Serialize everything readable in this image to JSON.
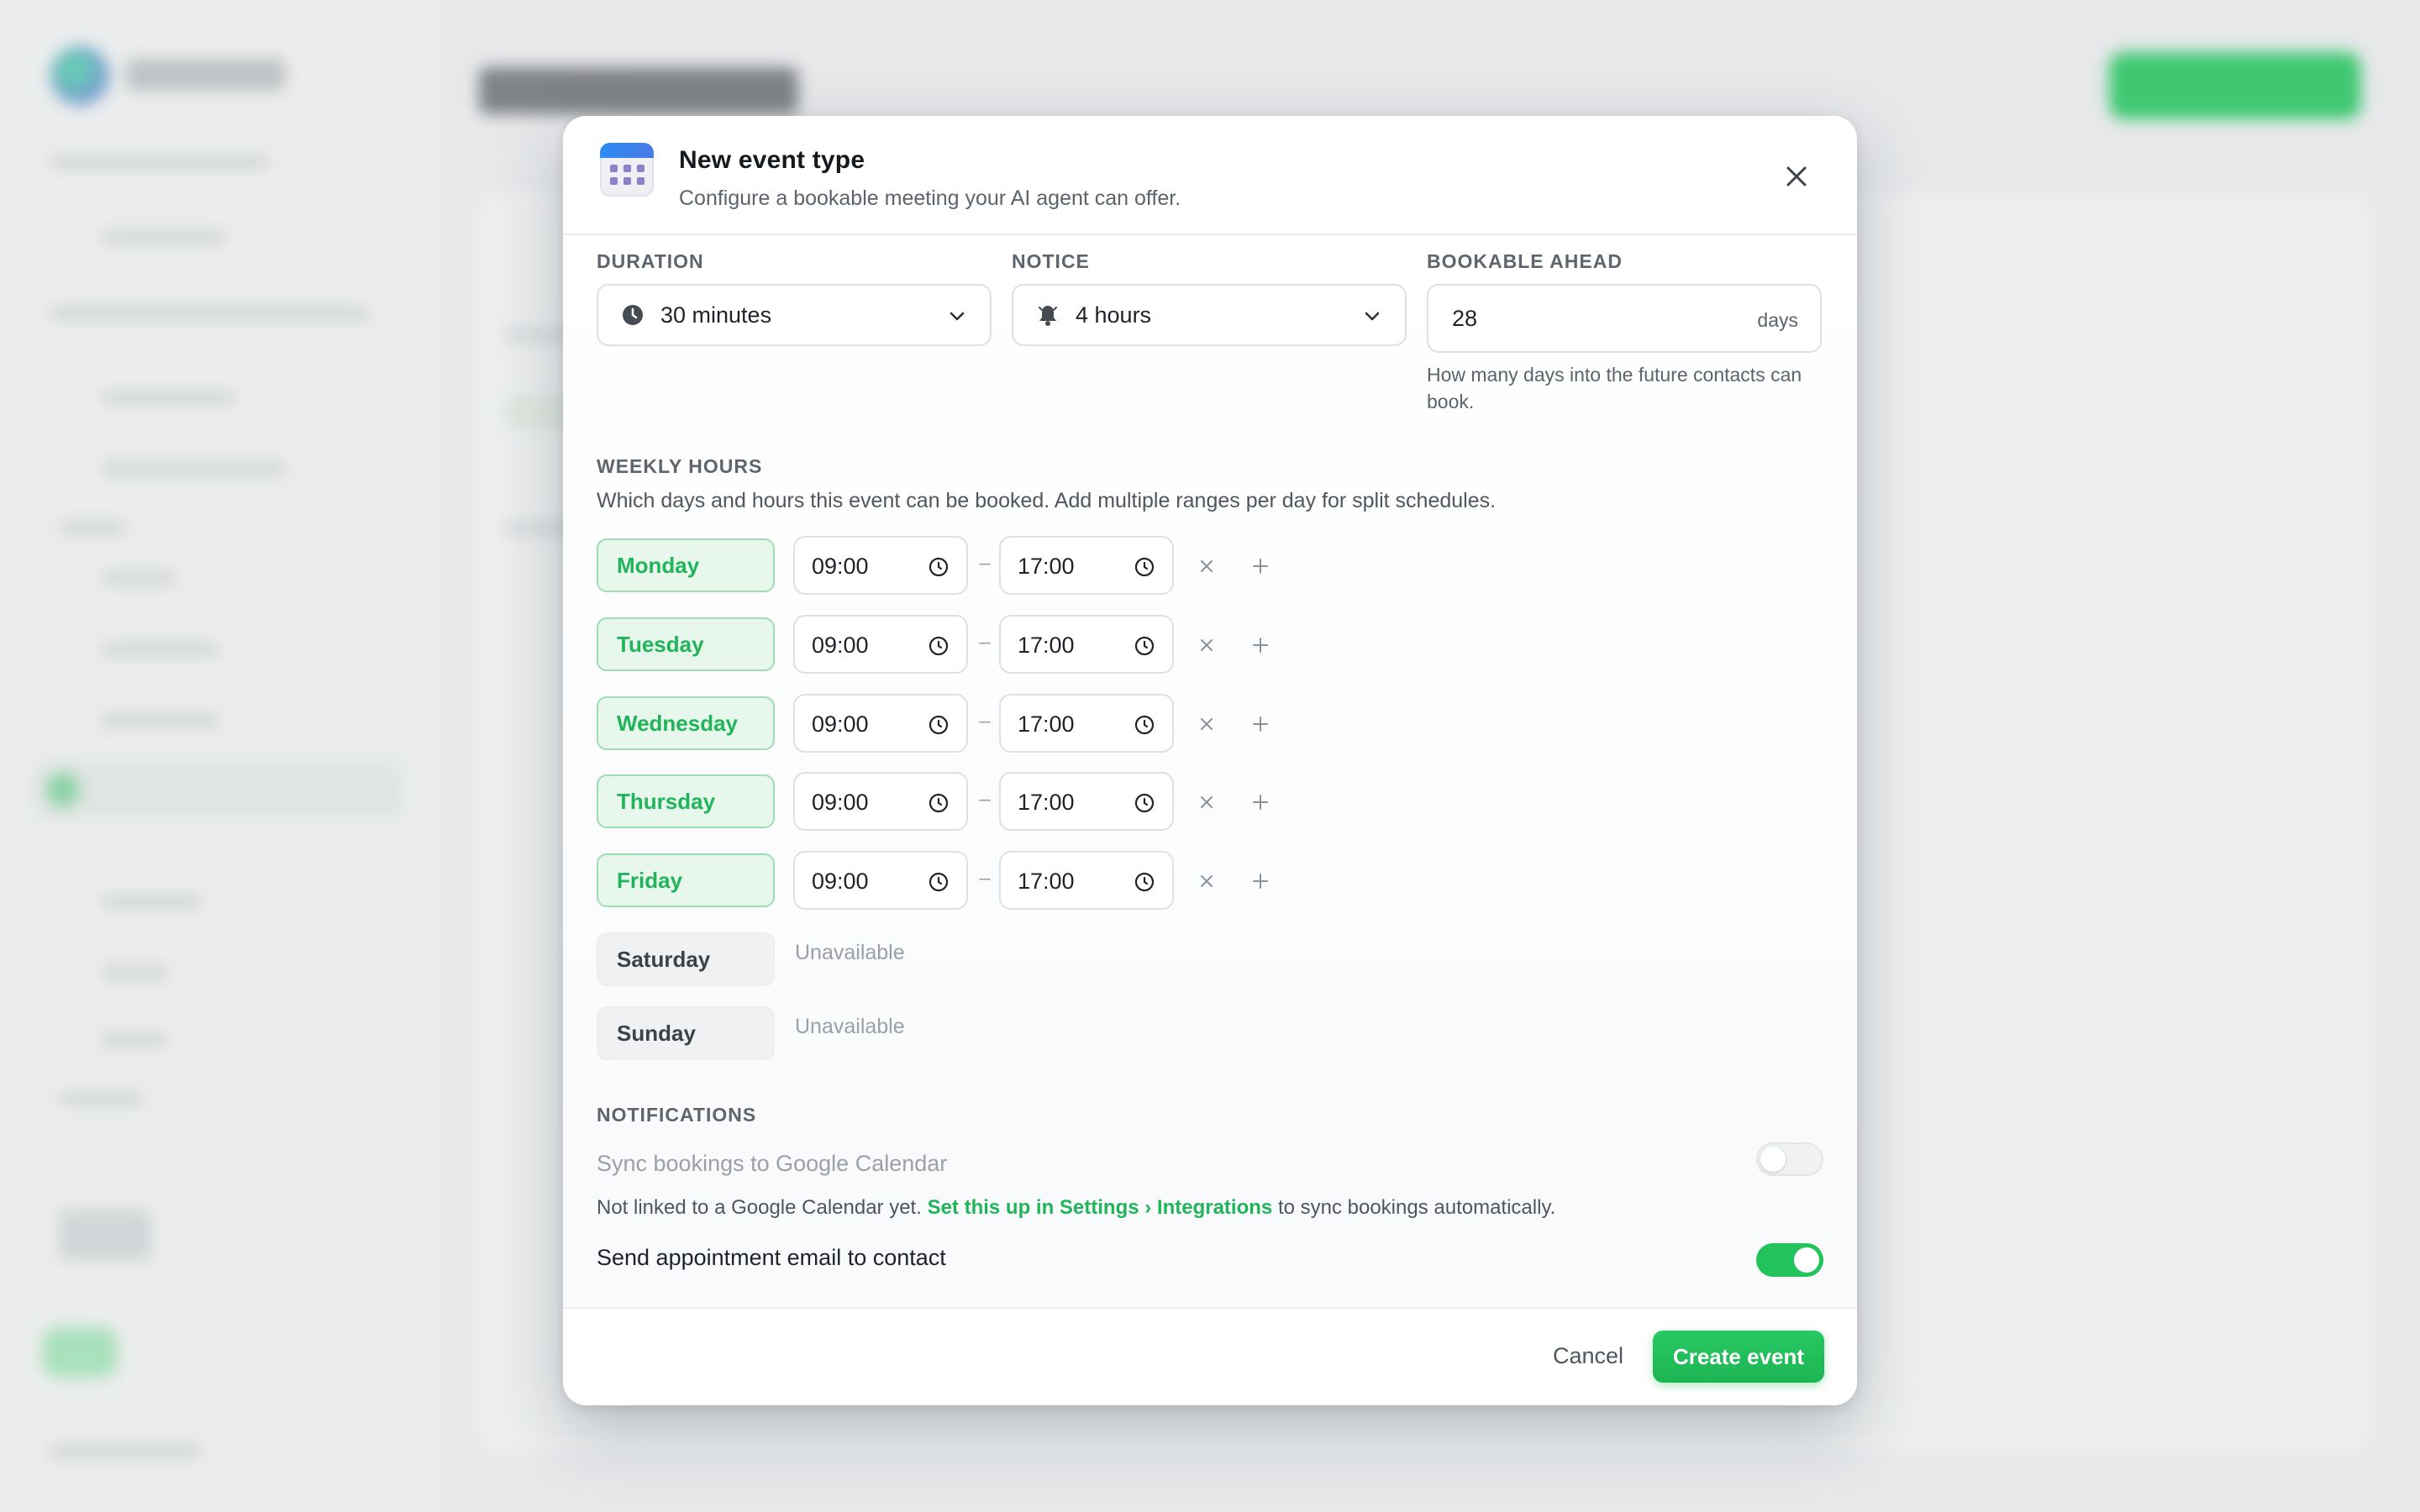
{
  "modal": {
    "title": "New event type",
    "subtitle": "Configure a bookable meeting your AI agent can offer.",
    "icon": "calendar-icon",
    "close_icon": "close-icon"
  },
  "duration": {
    "label": "DURATION",
    "value": "30 minutes",
    "icon": "clock-icon"
  },
  "notice": {
    "label": "NOTICE",
    "value": "4 hours",
    "icon": "bell-icon"
  },
  "bookable_ahead": {
    "label": "BOOKABLE AHEAD",
    "value": "28",
    "unit": "days",
    "helper": "How many days into the future contacts can book."
  },
  "weekly_hours": {
    "label": "WEEKLY HOURS",
    "description": "Which days and hours this event can be booked. Add multiple ranges per day for split schedules.",
    "separator": "–",
    "days": [
      {
        "name": "Monday",
        "enabled": true,
        "start": "09:00",
        "end": "17:00"
      },
      {
        "name": "Tuesday",
        "enabled": true,
        "start": "09:00",
        "end": "17:00"
      },
      {
        "name": "Wednesday",
        "enabled": true,
        "start": "09:00",
        "end": "17:00"
      },
      {
        "name": "Thursday",
        "enabled": true,
        "start": "09:00",
        "end": "17:00"
      },
      {
        "name": "Friday",
        "enabled": true,
        "start": "09:00",
        "end": "17:00"
      },
      {
        "name": "Saturday",
        "enabled": false,
        "status": "Unavailable"
      },
      {
        "name": "Sunday",
        "enabled": false,
        "status": "Unavailable"
      }
    ]
  },
  "notifications": {
    "label": "NOTIFICATIONS",
    "google_sync": {
      "label": "Sync bookings to Google Calendar",
      "enabled": false,
      "note_prefix": "Not linked to a Google Calendar yet.",
      "note_link": "Set this up in Settings › Integrations",
      "note_suffix": "to sync bookings automatically."
    },
    "email": {
      "label": "Send appointment email to contact",
      "enabled": true
    }
  },
  "footer": {
    "cancel_label": "Cancel",
    "create_label": "Create event"
  },
  "colors": {
    "accent": "#22c35d",
    "accent_text": "#21b45a"
  }
}
